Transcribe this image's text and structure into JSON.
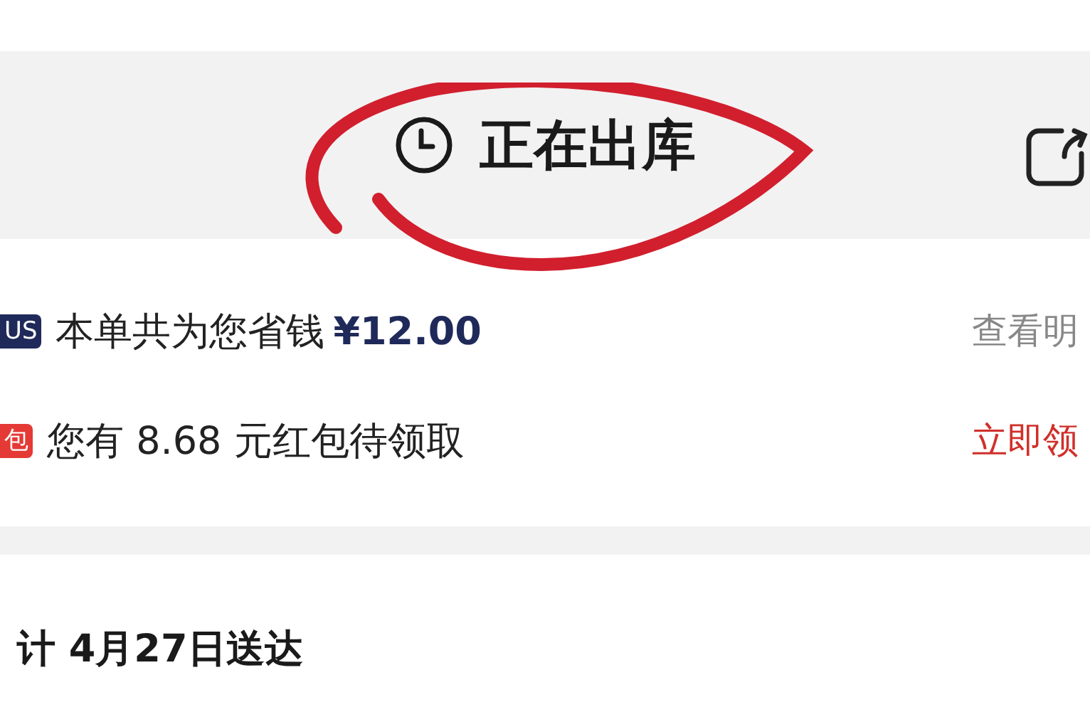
{
  "header": {
    "title": "正在出库"
  },
  "benefits": [
    {
      "kind": "plus",
      "badge": "US",
      "text": "本单共为您省钱",
      "amount": "¥12.00",
      "action": "查看明"
    },
    {
      "kind": "hongbao",
      "badge": "包",
      "text": "您有 8.68 元红包待领取",
      "action": "立即领"
    }
  ],
  "delivery": {
    "heading": "计 4月27日送达"
  }
}
